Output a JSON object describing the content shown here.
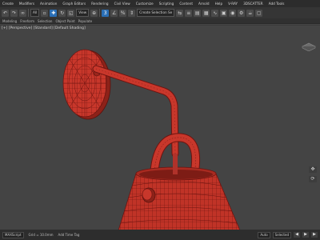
{
  "menubar": {
    "items": [
      "Create",
      "Modifiers",
      "Animation",
      "Graph Editors",
      "Rendering",
      "Civil View",
      "Customize",
      "Scripting",
      "Content",
      "Arnold",
      "Help",
      "V-RAY",
      "3DSCATTER",
      "Add Tools"
    ]
  },
  "toolbar": {
    "selection_filter": "All",
    "view_dropdown": "View",
    "named_selection": "Create Selection Se"
  },
  "ribbon": {
    "tabs": [
      "Modeling",
      "Freeform",
      "Selection",
      "Object Paint",
      "Populate"
    ]
  },
  "viewport": {
    "label": "[+] [Perspective] [Standard] [Default Shading]",
    "mesh_color": "#c8372b",
    "wire_color": "#6d1410",
    "background": "#444444"
  },
  "statusbar": {
    "left_text": "MAXScript",
    "grid": "Grid = 10.0mm",
    "add_time_tag": "Add Time Tag",
    "auto": "Auto",
    "selected": "Selected"
  },
  "icons": [
    "undo-icon",
    "redo-icon",
    "link-icon",
    "select-icon",
    "move-icon",
    "rotate-icon",
    "scale-icon",
    "snap-icon",
    "mirror-icon",
    "render-icon",
    "viewcube-icon",
    "pan-icon",
    "orbit-icon"
  ]
}
